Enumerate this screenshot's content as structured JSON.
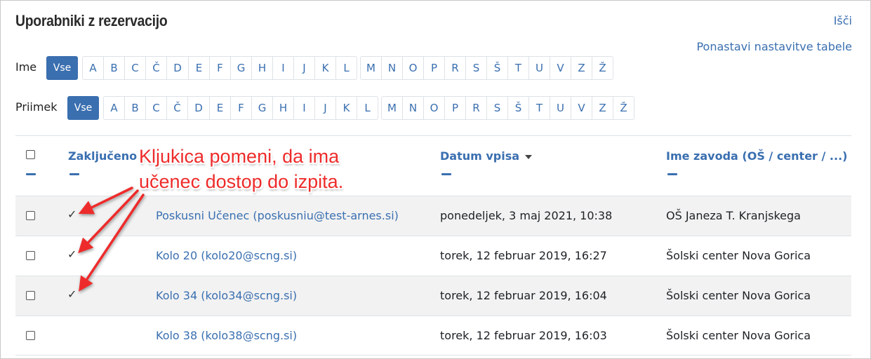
{
  "header": {
    "title": "Uporabniki z rezervacijo",
    "clear_label": "Išči",
    "reset_label": "Ponastavi nastavitve tabele"
  },
  "filters": {
    "first_name": {
      "label": "Ime",
      "all_label": "Vse",
      "letters": [
        "A",
        "B",
        "C",
        "Č",
        "D",
        "E",
        "F",
        "G",
        "H",
        "I",
        "J",
        "K",
        "L",
        "M",
        "N",
        "O",
        "P",
        "R",
        "S",
        "Š",
        "T",
        "U",
        "V",
        "Z",
        "Ž"
      ]
    },
    "last_name": {
      "label": "Priimek",
      "all_label": "Vse",
      "letters": [
        "A",
        "B",
        "C",
        "Č",
        "D",
        "E",
        "F",
        "G",
        "H",
        "I",
        "J",
        "K",
        "L",
        "M",
        "N",
        "O",
        "P",
        "R",
        "S",
        "Š",
        "T",
        "U",
        "V",
        "Z",
        "Ž"
      ]
    }
  },
  "table": {
    "columns": {
      "completed": "Zaključeno",
      "enrol_date": "Datum vpisa",
      "institution": "Ime zavoda (OŠ / center / ...)"
    },
    "rows": [
      {
        "completed": "✓",
        "user": "Poskusni Učenec (poskusniu@test-arnes.si)",
        "date": "ponedeljek, 3 maj 2021, 10:38",
        "institution": "OŠ Janeza T. Kranjskega"
      },
      {
        "completed": "✓",
        "user": "Kolo 20 (kolo20@scng.si)",
        "date": "torek, 12 februar 2019, 16:27",
        "institution": "Šolski center Nova Gorica"
      },
      {
        "completed": "✓",
        "user": "Kolo 34 (kolo34@scng.si)",
        "date": "torek, 12 februar 2019, 16:04",
        "institution": "Šolski center Nova Gorica"
      },
      {
        "completed": "",
        "user": "Kolo 38 (kolo38@scng.si)",
        "date": "torek, 12 februar 2019, 16:03",
        "institution": "Šolski center Nova Gorica"
      }
    ]
  },
  "annotation": {
    "line1": "Kljukica pomeni, da ima",
    "line2": "učenec dostop do izpita."
  },
  "colors": {
    "accent": "#3a6fb0",
    "annotation": "#ee2b2b",
    "row_alt": "#f2f2f2"
  }
}
